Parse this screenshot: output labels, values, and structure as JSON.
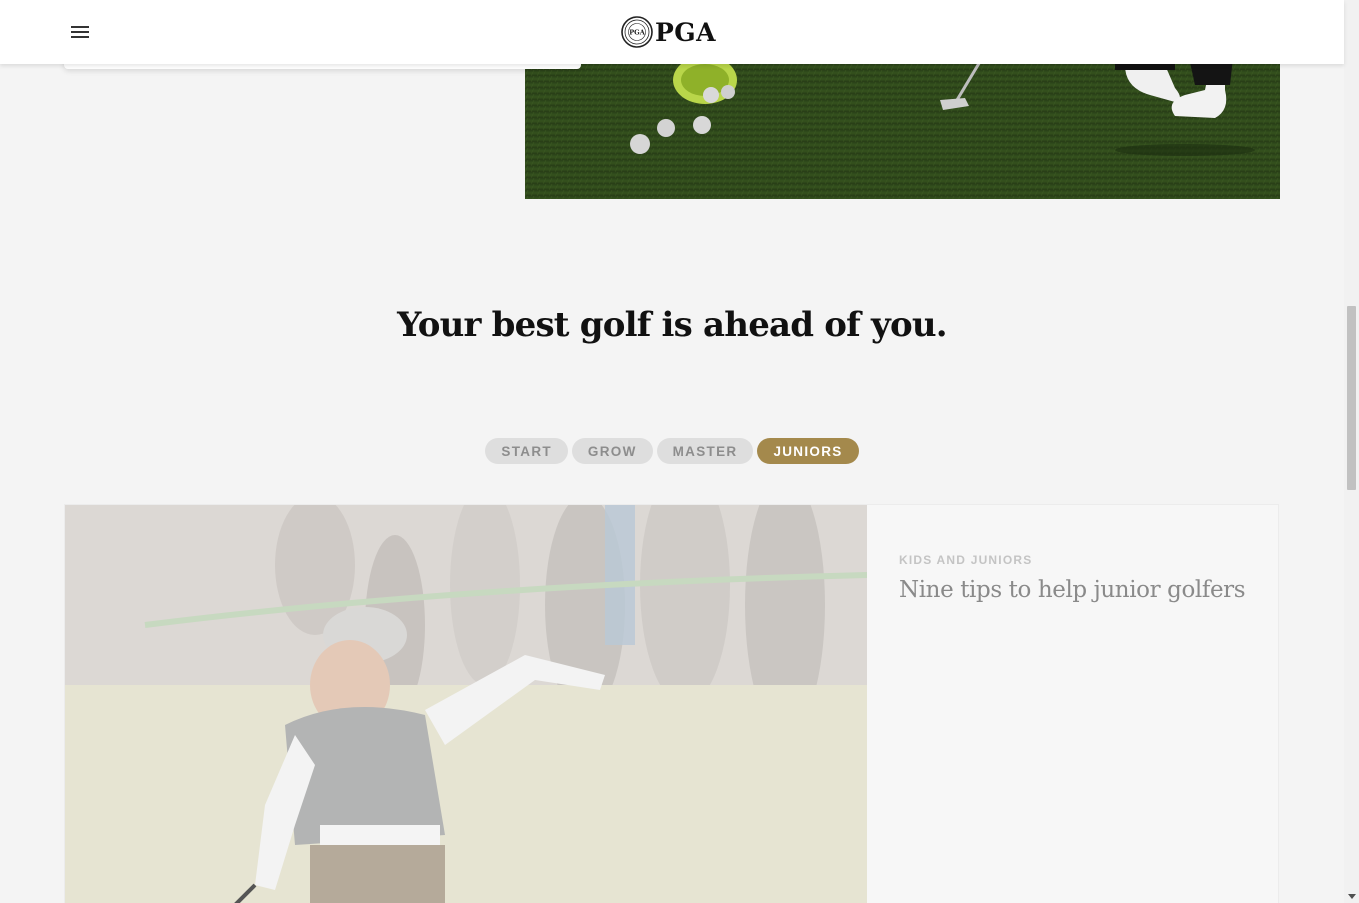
{
  "header": {
    "logo_text": "PGA",
    "logo_badge_text": "PGA",
    "menu_icon": "hamburger-menu-icon"
  },
  "hero": {
    "image_description_icon": "golf-practice-range-image"
  },
  "section": {
    "title": "Your best golf is ahead of you."
  },
  "tabs": [
    {
      "label": "START",
      "active": false
    },
    {
      "label": "GROW",
      "active": false
    },
    {
      "label": "MASTER",
      "active": false
    },
    {
      "label": "JUNIORS",
      "active": true
    }
  ],
  "article": {
    "category": "KIDS AND JUNIORS",
    "title": "Nine tips to help junior golfers"
  },
  "colors": {
    "accent": "#a4894c",
    "tab_inactive_bg": "#dedede",
    "tab_inactive_text": "#8d8d8d",
    "page_bg": "#f4f4f4"
  }
}
